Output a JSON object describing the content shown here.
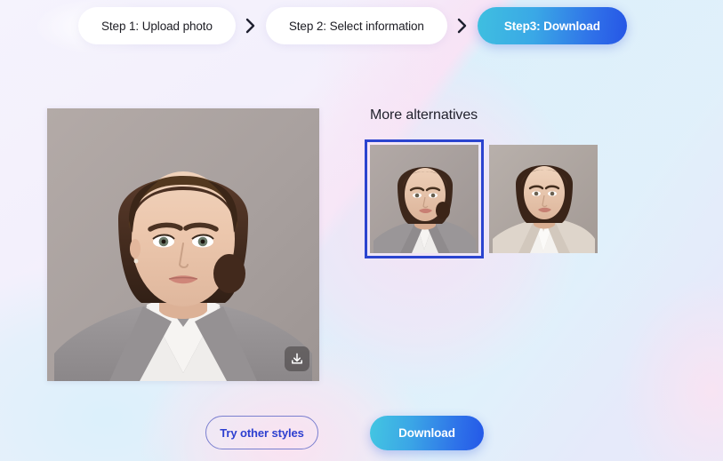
{
  "stepper": {
    "steps": [
      {
        "label": "Step 1: Upload photo",
        "state": "done"
      },
      {
        "label": "Step 2: Select information",
        "state": "done"
      },
      {
        "label": "Step3: Download",
        "state": "active"
      }
    ],
    "separator_icon": "chevron-right-icon"
  },
  "main_preview": {
    "alt": "passport photo preview of woman in grey blazer on grey background",
    "download_icon": "download-icon"
  },
  "alternatives": {
    "title": "More alternatives",
    "items": [
      {
        "alt": "alternative passport photo 1, grey blazer",
        "selected": true
      },
      {
        "alt": "alternative passport photo 2, beige blazer",
        "selected": false
      }
    ]
  },
  "actions": {
    "try_other_styles_label": "Try other styles",
    "download_label": "Download"
  },
  "colors": {
    "accent_blue": "#2458e8",
    "accent_cyan": "#43c6e2",
    "selection_border": "#2b44cf",
    "outline_button_border": "#7a7fcf",
    "outline_button_text": "#2d3fd0",
    "text_primary": "#1d1d24",
    "bg_lavender": "#f3f0fc",
    "bg_pink": "#f8e0f4",
    "bg_cyan": "#dbf0fb"
  }
}
